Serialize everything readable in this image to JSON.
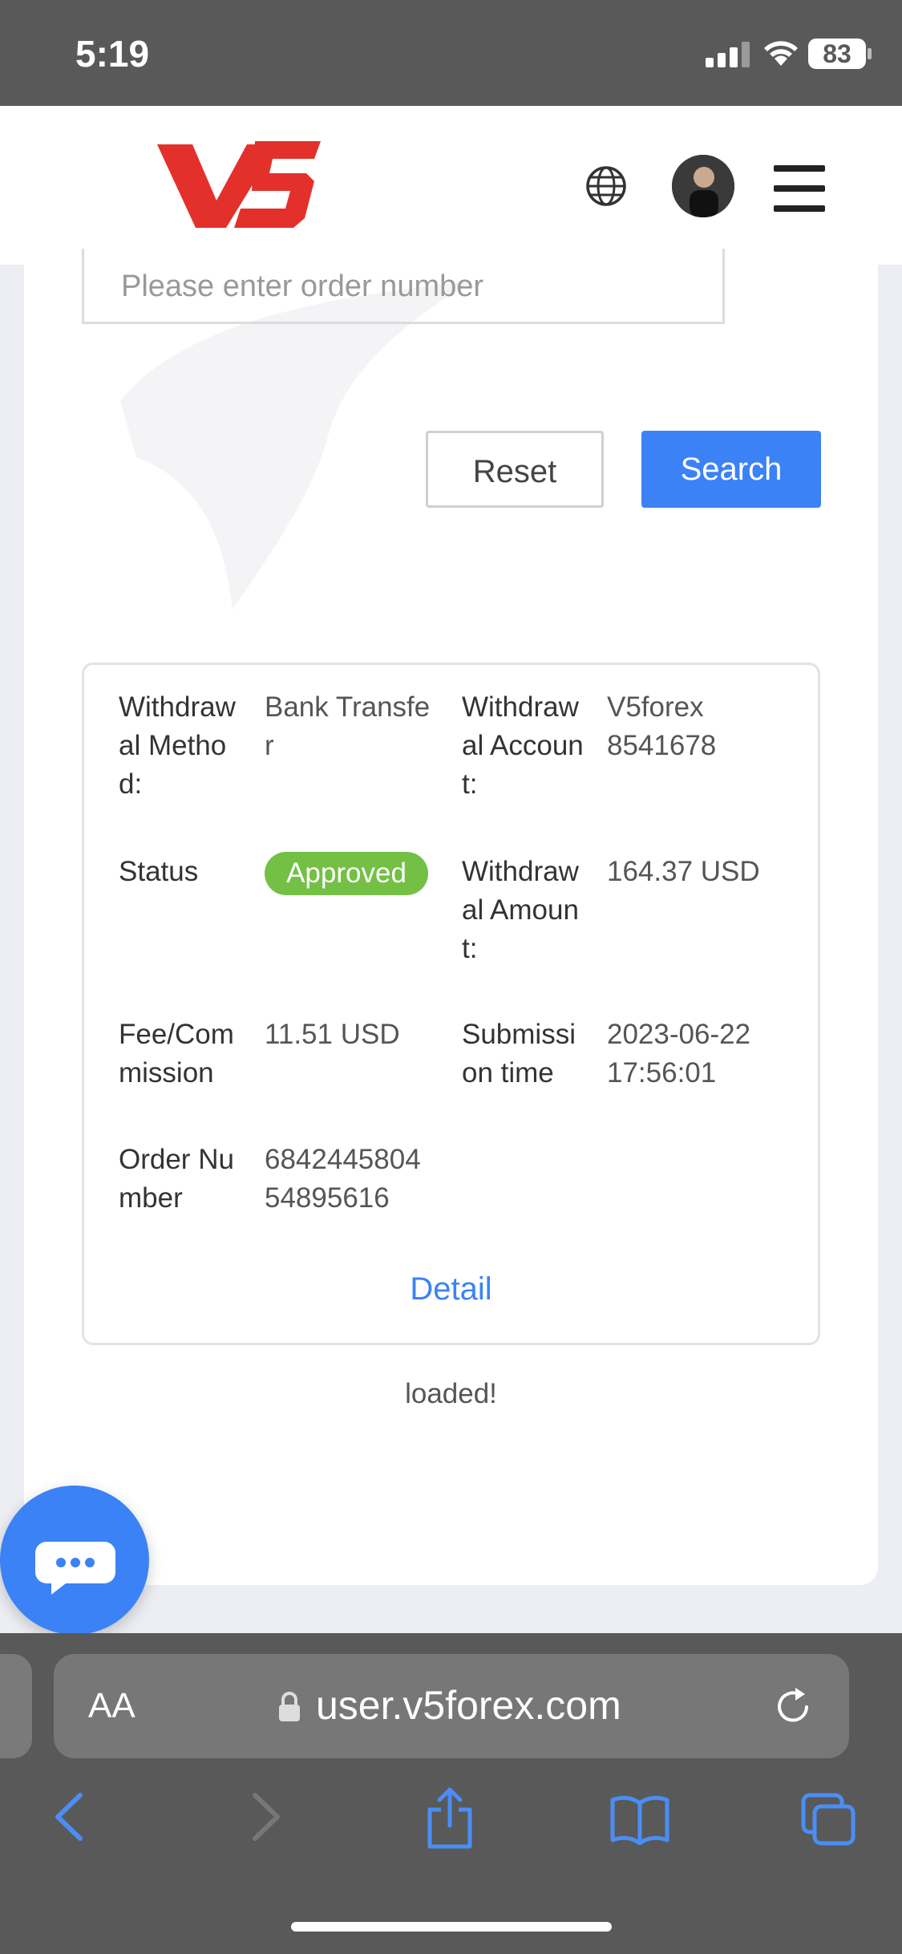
{
  "status_bar": {
    "time": "5:19",
    "battery": "83"
  },
  "header": {
    "logo_text": "V5"
  },
  "search": {
    "placeholder": "Please enter order number",
    "reset_label": "Reset",
    "search_label": "Search"
  },
  "record": {
    "withdrawal_method_label_lines": [
      "Withdraw",
      "al Metho",
      "d:"
    ],
    "withdrawal_method_value_lines": [
      "Bank Transfe",
      "r"
    ],
    "withdrawal_account_label_lines": [
      "Withdraw",
      "al Accoun",
      "t:"
    ],
    "withdrawal_account_value_lines": [
      "V5forex",
      "8541678"
    ],
    "status_label": "Status",
    "status_value": "Approved",
    "withdrawal_amount_label_lines": [
      "Withdraw",
      "al Amoun",
      "t:"
    ],
    "withdrawal_amount_value": "164.37 USD",
    "fee_label_lines": [
      "Fee/Com",
      "mission"
    ],
    "fee_value": "11.51 USD",
    "submission_label_lines": [
      "Submissi",
      "on time"
    ],
    "submission_value_lines": [
      "2023-06-22",
      "17:56:01"
    ],
    "order_number_label_lines": [
      "Order Nu",
      "mber"
    ],
    "order_number_value_lines": [
      "6842445804",
      "54895616"
    ],
    "detail_label": "Detail"
  },
  "loaded_text": "loaded!",
  "browser": {
    "text_size_label": "AA",
    "url": "user.v5forex.com"
  },
  "colors": {
    "accent": "#3b82f6",
    "approved": "#73c045",
    "logo_red": "#e4302b"
  }
}
